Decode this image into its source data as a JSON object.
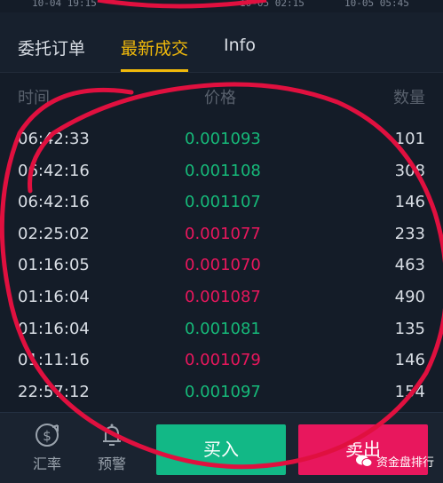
{
  "top_axis": {
    "labels": [
      "10-04 19:15",
      "10-05 02:15",
      "10-05 05:45"
    ]
  },
  "tabs": [
    {
      "label": "委托订单",
      "active": false
    },
    {
      "label": "最新成交",
      "active": true
    },
    {
      "label": "Info",
      "active": false
    }
  ],
  "table": {
    "headers": {
      "time": "时间",
      "price": "价格",
      "qty": "数量"
    },
    "rows": [
      {
        "time": "06:42:33",
        "price": "0.001093",
        "qty": "101",
        "side": "buy"
      },
      {
        "time": "06:42:16",
        "price": "0.001108",
        "qty": "308",
        "side": "buy"
      },
      {
        "time": "06:42:16",
        "price": "0.001107",
        "qty": "146",
        "side": "buy"
      },
      {
        "time": "02:25:02",
        "price": "0.001077",
        "qty": "233",
        "side": "sell"
      },
      {
        "time": "01:16:05",
        "price": "0.001070",
        "qty": "463",
        "side": "sell"
      },
      {
        "time": "01:16:04",
        "price": "0.001087",
        "qty": "490",
        "side": "sell"
      },
      {
        "time": "01:16:04",
        "price": "0.001081",
        "qty": "135",
        "side": "buy"
      },
      {
        "time": "01:11:16",
        "price": "0.001079",
        "qty": "146",
        "side": "sell"
      },
      {
        "time": "22:57:12",
        "price": "0.001097",
        "qty": "154",
        "side": "buy"
      }
    ]
  },
  "bottom_bar": {
    "rate_label": "汇率",
    "alert_label": "预警",
    "buy_label": "买入",
    "sell_label": "卖出"
  },
  "watermark": "资金盘排行",
  "colors": {
    "buy": "#16b979",
    "sell": "#e8175d",
    "accent": "#f0b90b"
  }
}
